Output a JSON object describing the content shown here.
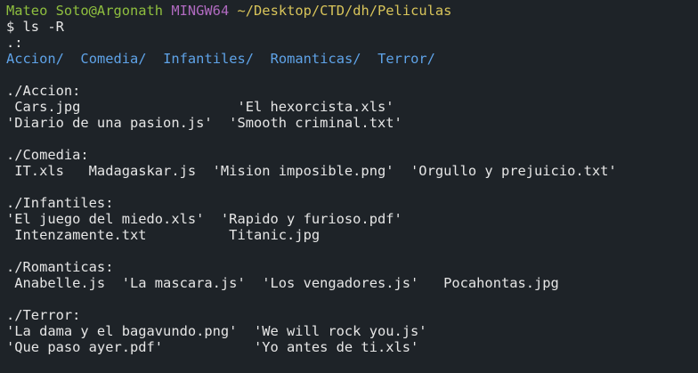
{
  "prompt": {
    "user_host": "Mateo Soto@Argonath",
    "env": "MINGW64",
    "cwd": "~/Desktop/CTD/dh/Peliculas"
  },
  "command": "$ ls -R",
  "root": {
    "header": ".:",
    "entries": [
      "Accion/",
      "Comedia/",
      "Infantiles/",
      "Romanticas/",
      "Terror/"
    ]
  },
  "listing": [
    {
      "header": "./Accion:",
      "rows": [
        " Cars.jpg                   'El hexorcista.xls'",
        "'Diario de una pasion.js'  'Smooth criminal.txt'"
      ]
    },
    {
      "header": "./Comedia:",
      "rows": [
        " IT.xls   Madagaskar.js  'Mision imposible.png'  'Orgullo y prejuicio.txt'"
      ]
    },
    {
      "header": "./Infantiles:",
      "rows": [
        "'El juego del miedo.xls'  'Rapido y furioso.pdf'",
        " Intenzamente.txt          Titanic.jpg"
      ]
    },
    {
      "header": "./Romanticas:",
      "rows": [
        " Anabelle.js  'La mascara.js'  'Los vengadores.js'   Pocahontas.jpg"
      ]
    },
    {
      "header": "./Terror:",
      "rows": [
        "'La dama y el bagavundo.png'  'We will rock you.js'",
        "'Que paso ayer.pdf'           'Yo antes de ti.xls'"
      ]
    }
  ]
}
